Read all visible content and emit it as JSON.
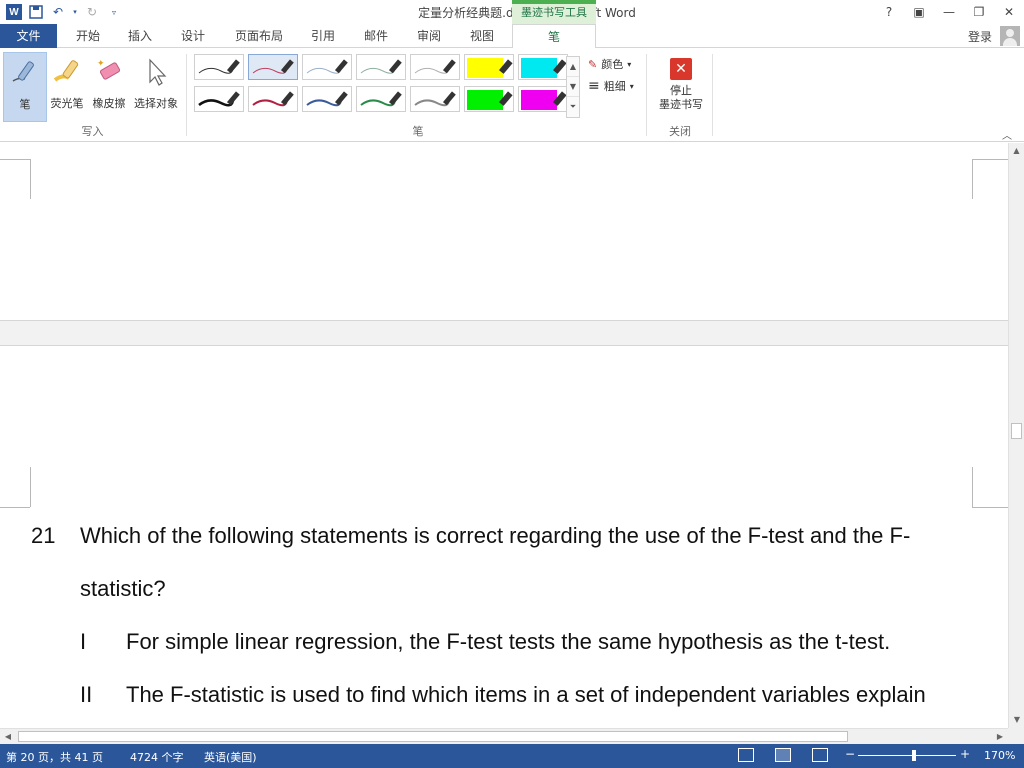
{
  "window": {
    "title": "定量分析经典题.docx - Microsoft Word",
    "context_tool": "墨迹书写工具",
    "controls": [
      "?",
      "▣",
      "—",
      "❐",
      "✕"
    ]
  },
  "tabs": [
    "文件",
    "开始",
    "插入",
    "设计",
    "页面布局",
    "引用",
    "邮件",
    "审阅",
    "视图",
    "笔"
  ],
  "active_tab": "笔",
  "account": {
    "signin": "登录"
  },
  "ribbon": {
    "write_group": {
      "label": "写入",
      "tools": [
        "笔",
        "荧光笔",
        "橡皮擦",
        "选择对象"
      ]
    },
    "pens_group": {
      "label": "笔"
    },
    "color_label": "颜色",
    "thickness_label": "粗细",
    "close_group": {
      "label": "关闭",
      "stop_label_1": "停止",
      "stop_label_2": "墨迹书写"
    }
  },
  "document": {
    "question_number": "21",
    "question_line1": "Which of the following statements is correct regarding the use of the F-test and the F-",
    "question_line2": "statistic?",
    "items": [
      {
        "roman": "I",
        "text": "For simple linear regression, the F-test tests the same hypothesis as the t-test."
      },
      {
        "roman": "II",
        "text": "The F-statistic is used to find which items in a set of independent variables explain"
      }
    ]
  },
  "statusbar": {
    "page": "第 20 页，共 41 页",
    "words": "4724 个字",
    "language": "英语(美国)",
    "zoom": "170%"
  },
  "colors": {
    "brand": "#2b579a",
    "pen_tab": "#217346",
    "stop": "#d9372b"
  }
}
